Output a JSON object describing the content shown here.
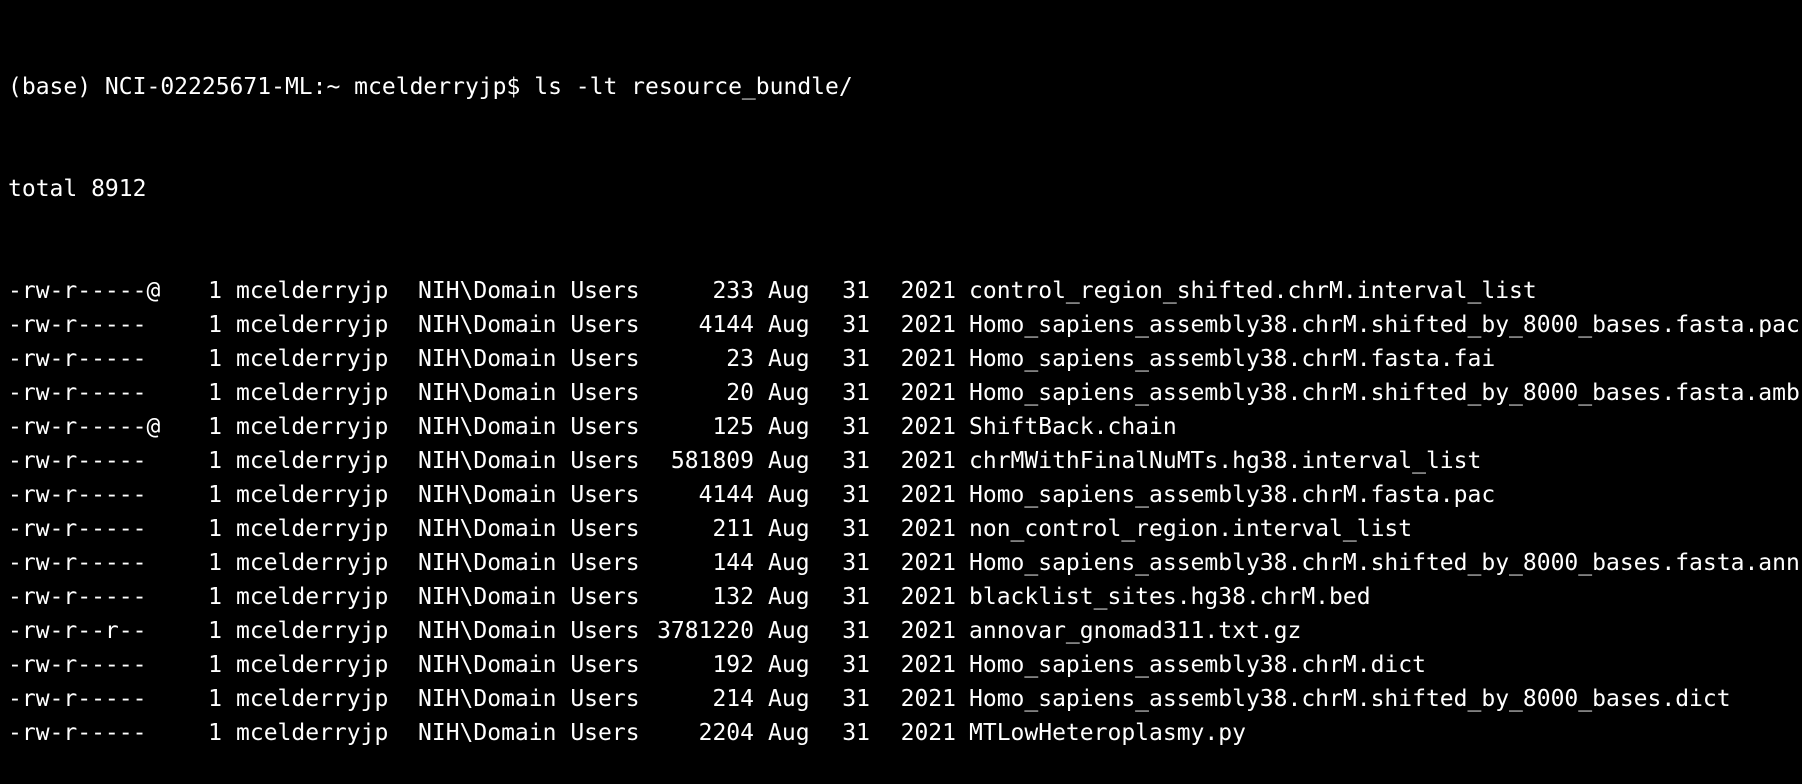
{
  "terminal": {
    "prompt": "(base) NCI-02225671-ML:~ mcelderryjp$",
    "command": "ls -lt resource_bundle/",
    "total_line": "total 8912",
    "colors": {
      "background": "#000000",
      "text": "#ffffff"
    },
    "entries": [
      {
        "perm": "-rw-r-----@",
        "links": "1",
        "owner": "mcelderryjp",
        "group": "NIH\\Domain Users",
        "size": "233",
        "month": "Aug",
        "day": "31",
        "year": "2021",
        "name": "control_region_shifted.chrM.interval_list"
      },
      {
        "perm": "-rw-r-----",
        "links": "1",
        "owner": "mcelderryjp",
        "group": "NIH\\Domain Users",
        "size": "4144",
        "month": "Aug",
        "day": "31",
        "year": "2021",
        "name": "Homo_sapiens_assembly38.chrM.shifted_by_8000_bases.fasta.pac"
      },
      {
        "perm": "-rw-r-----",
        "links": "1",
        "owner": "mcelderryjp",
        "group": "NIH\\Domain Users",
        "size": "23",
        "month": "Aug",
        "day": "31",
        "year": "2021",
        "name": "Homo_sapiens_assembly38.chrM.fasta.fai"
      },
      {
        "perm": "-rw-r-----",
        "links": "1",
        "owner": "mcelderryjp",
        "group": "NIH\\Domain Users",
        "size": "20",
        "month": "Aug",
        "day": "31",
        "year": "2021",
        "name": "Homo_sapiens_assembly38.chrM.shifted_by_8000_bases.fasta.amb"
      },
      {
        "perm": "-rw-r-----@",
        "links": "1",
        "owner": "mcelderryjp",
        "group": "NIH\\Domain Users",
        "size": "125",
        "month": "Aug",
        "day": "31",
        "year": "2021",
        "name": "ShiftBack.chain"
      },
      {
        "perm": "-rw-r-----",
        "links": "1",
        "owner": "mcelderryjp",
        "group": "NIH\\Domain Users",
        "size": "581809",
        "month": "Aug",
        "day": "31",
        "year": "2021",
        "name": "chrMWithFinalNuMTs.hg38.interval_list"
      },
      {
        "perm": "-rw-r-----",
        "links": "1",
        "owner": "mcelderryjp",
        "group": "NIH\\Domain Users",
        "size": "4144",
        "month": "Aug",
        "day": "31",
        "year": "2021",
        "name": "Homo_sapiens_assembly38.chrM.fasta.pac"
      },
      {
        "perm": "-rw-r-----",
        "links": "1",
        "owner": "mcelderryjp",
        "group": "NIH\\Domain Users",
        "size": "211",
        "month": "Aug",
        "day": "31",
        "year": "2021",
        "name": "non_control_region.interval_list"
      },
      {
        "perm": "-rw-r-----",
        "links": "1",
        "owner": "mcelderryjp",
        "group": "NIH\\Domain Users",
        "size": "144",
        "month": "Aug",
        "day": "31",
        "year": "2021",
        "name": "Homo_sapiens_assembly38.chrM.shifted_by_8000_bases.fasta.ann"
      },
      {
        "perm": "-rw-r-----",
        "links": "1",
        "owner": "mcelderryjp",
        "group": "NIH\\Domain Users",
        "size": "132",
        "month": "Aug",
        "day": "31",
        "year": "2021",
        "name": "blacklist_sites.hg38.chrM.bed"
      },
      {
        "perm": "-rw-r--r--",
        "links": "1",
        "owner": "mcelderryjp",
        "group": "NIH\\Domain Users",
        "size": "3781220",
        "month": "Aug",
        "day": "31",
        "year": "2021",
        "name": "annovar_gnomad311.txt.gz"
      },
      {
        "perm": "-rw-r-----",
        "links": "1",
        "owner": "mcelderryjp",
        "group": "NIH\\Domain Users",
        "size": "192",
        "month": "Aug",
        "day": "31",
        "year": "2021",
        "name": "Homo_sapiens_assembly38.chrM.dict"
      },
      {
        "perm": "-rw-r-----",
        "links": "1",
        "owner": "mcelderryjp",
        "group": "NIH\\Domain Users",
        "size": "214",
        "month": "Aug",
        "day": "31",
        "year": "2021",
        "name": "Homo_sapiens_assembly38.chrM.shifted_by_8000_bases.dict"
      },
      {
        "perm": "-rw-r-----",
        "links": "1",
        "owner": "mcelderryjp",
        "group": "NIH\\Domain Users",
        "size": "2204",
        "month": "Aug",
        "day": "31",
        "year": "2021",
        "name": "MTLowHeteroplasmy.py"
      }
    ]
  }
}
